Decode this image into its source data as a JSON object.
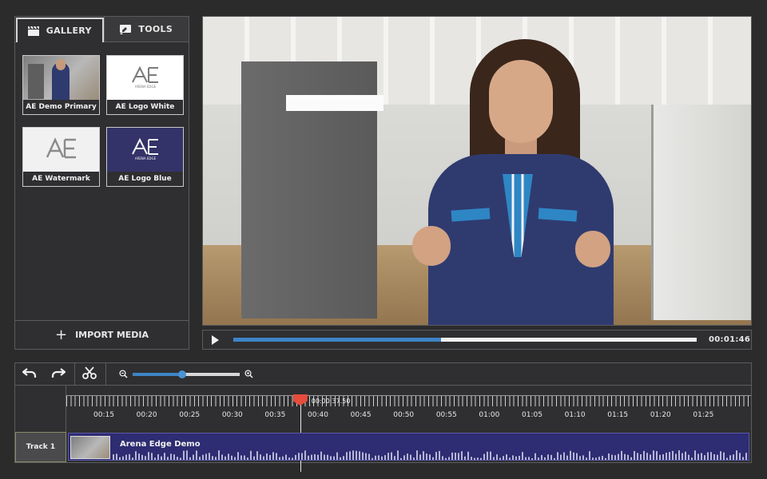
{
  "panel": {
    "tabs": [
      {
        "label": "GALLERY",
        "active": true,
        "icon": "clapperboard-icon"
      },
      {
        "label": "TOOLS",
        "active": false,
        "icon": "tools-icon"
      }
    ],
    "media": [
      {
        "caption": "AE Demo Primary",
        "style": "photo"
      },
      {
        "caption": "AE Logo White",
        "style": "white",
        "logo_text": "ARENA EDGE"
      },
      {
        "caption": "AE Watermark",
        "style": "light"
      },
      {
        "caption": "AE Logo Blue",
        "style": "blue",
        "logo_text": "ARENA EDGE"
      }
    ],
    "import_label": "IMPORT MEDIA"
  },
  "player": {
    "progress": 0.449,
    "time": "00:01:46"
  },
  "timeline": {
    "zoom_level": 0.46,
    "playhead_time": "00:00:37.50",
    "playhead_fraction": 0.342,
    "ticks": [
      "00:15",
      "00:20",
      "00:25",
      "00:30",
      "00:35",
      "00:40",
      "00:45",
      "00:50",
      "00:55",
      "01:00",
      "01:05",
      "01:10",
      "01:15",
      "01:20",
      "01:25"
    ],
    "track": {
      "label": "Track 1",
      "clip_name": "Arena Edge Demo"
    }
  },
  "colors": {
    "accent": "#3d84c6",
    "playhead": "#e74c3c",
    "clip": "#2e2c72",
    "background": "#2b2b2c"
  }
}
